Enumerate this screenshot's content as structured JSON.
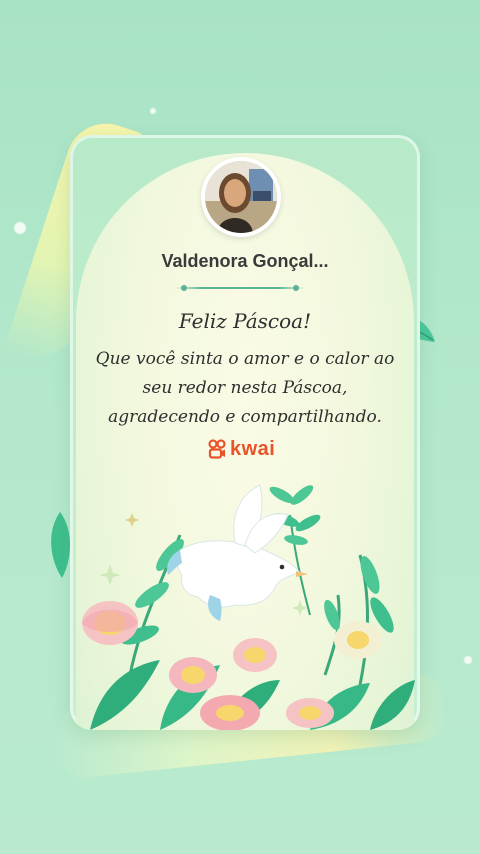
{
  "user": {
    "name": "Valdenora Gonçal..."
  },
  "greeting": {
    "title": "Feliz Páscoa!",
    "line1": "Que você sinta o amor e o calor ao",
    "line2": "seu redor nesta Páscoa,",
    "line3": "agradecendo e compartilhando."
  },
  "brand": {
    "name": "kwai",
    "color": "#e9532a",
    "icon": "kwai-logo-icon"
  },
  "colors": {
    "background": "#a8e3c4",
    "accent": "#5ab496",
    "text": "#2f2f2f"
  },
  "decorations": [
    "dove-icon",
    "flower-icon",
    "leaf-icon",
    "sparkle-icon",
    "ribbon"
  ]
}
